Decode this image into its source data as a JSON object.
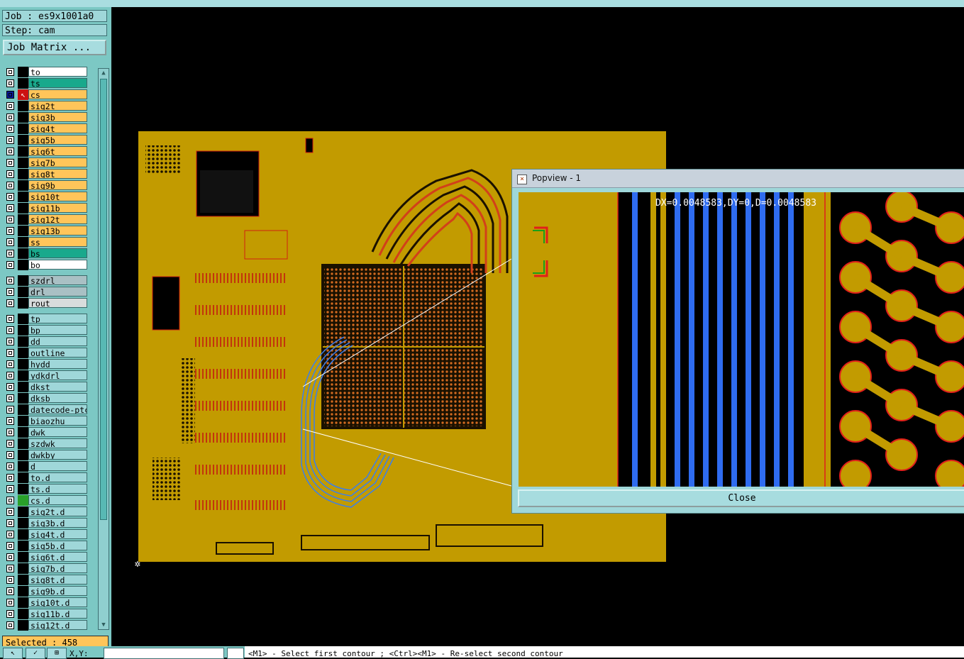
{
  "app": {
    "job_label": "Job : es9x1001a0",
    "step_label": "Step: cam",
    "job_matrix_button": "Job Matrix ...",
    "selected_count": "Selected : 458",
    "xy_label": "X,Y:",
    "status_text": "<M1> - Select first contour ; <Ctrl><M1> - Re-select second contour"
  },
  "layers": [
    {
      "name": "to",
      "color": "w"
    },
    {
      "name": "ts",
      "color": "g"
    },
    {
      "name": "cs",
      "color": "o",
      "active": true
    },
    {
      "name": "sig2t",
      "color": "o"
    },
    {
      "name": "sig3b",
      "color": "o"
    },
    {
      "name": "sig4t",
      "color": "o"
    },
    {
      "name": "sig5b",
      "color": "o"
    },
    {
      "name": "sig6t",
      "color": "o"
    },
    {
      "name": "sig7b",
      "color": "o"
    },
    {
      "name": "sig8t",
      "color": "o"
    },
    {
      "name": "sig9b",
      "color": "o"
    },
    {
      "name": "sig10t",
      "color": "o"
    },
    {
      "name": "sig11b",
      "color": "o"
    },
    {
      "name": "sig12t",
      "color": "o"
    },
    {
      "name": "sig13b",
      "color": "o"
    },
    {
      "name": "ss",
      "color": "o"
    },
    {
      "name": "bs",
      "color": "g"
    },
    {
      "name": "bo",
      "color": "w"
    },
    {
      "name": "szdrl",
      "color": "gr",
      "gap": true
    },
    {
      "name": "drl",
      "color": "gr"
    },
    {
      "name": "rout",
      "color": "lg"
    },
    {
      "name": "tp",
      "color": "b",
      "gap": true
    },
    {
      "name": "bp",
      "color": "b"
    },
    {
      "name": "dd",
      "color": "b"
    },
    {
      "name": "outline",
      "color": "b"
    },
    {
      "name": "hydd",
      "color": "b"
    },
    {
      "name": "ydkdrl",
      "color": "b"
    },
    {
      "name": "dkst",
      "color": "b"
    },
    {
      "name": "dksb",
      "color": "b"
    },
    {
      "name": "datecode-ptc",
      "color": "b"
    },
    {
      "name": "biaozhu",
      "color": "b"
    },
    {
      "name": "dwk",
      "color": "b"
    },
    {
      "name": "szdwk",
      "color": "b"
    },
    {
      "name": "dwkby",
      "color": "b"
    },
    {
      "name": "d",
      "color": "b"
    },
    {
      "name": "to.d",
      "color": "b"
    },
    {
      "name": "ts.d",
      "color": "b"
    },
    {
      "name": "cs.d",
      "color": "b",
      "slot": "green"
    },
    {
      "name": "sig2t.d",
      "color": "b"
    },
    {
      "name": "sig3b.d",
      "color": "b"
    },
    {
      "name": "sig4t.d",
      "color": "b"
    },
    {
      "name": "sig5b.d",
      "color": "b"
    },
    {
      "name": "sig6t.d",
      "color": "b"
    },
    {
      "name": "sig7b.d",
      "color": "b"
    },
    {
      "name": "sig8t.d",
      "color": "b"
    },
    {
      "name": "sig9b.d",
      "color": "b"
    },
    {
      "name": "sig10t.d",
      "color": "b"
    },
    {
      "name": "sig11b.d",
      "color": "b"
    },
    {
      "name": "sig12t.d",
      "color": "b"
    }
  ],
  "popview": {
    "title": "Popview - 1",
    "measurement": "DX=0.0048583,DY=0,D=0.0048583",
    "close_label": "Close"
  },
  "colors": {
    "copper": "#c29b00",
    "panel": "#7cc8c4",
    "trace_blue": "#3a7ef0",
    "outline_red": "#e0201a"
  }
}
